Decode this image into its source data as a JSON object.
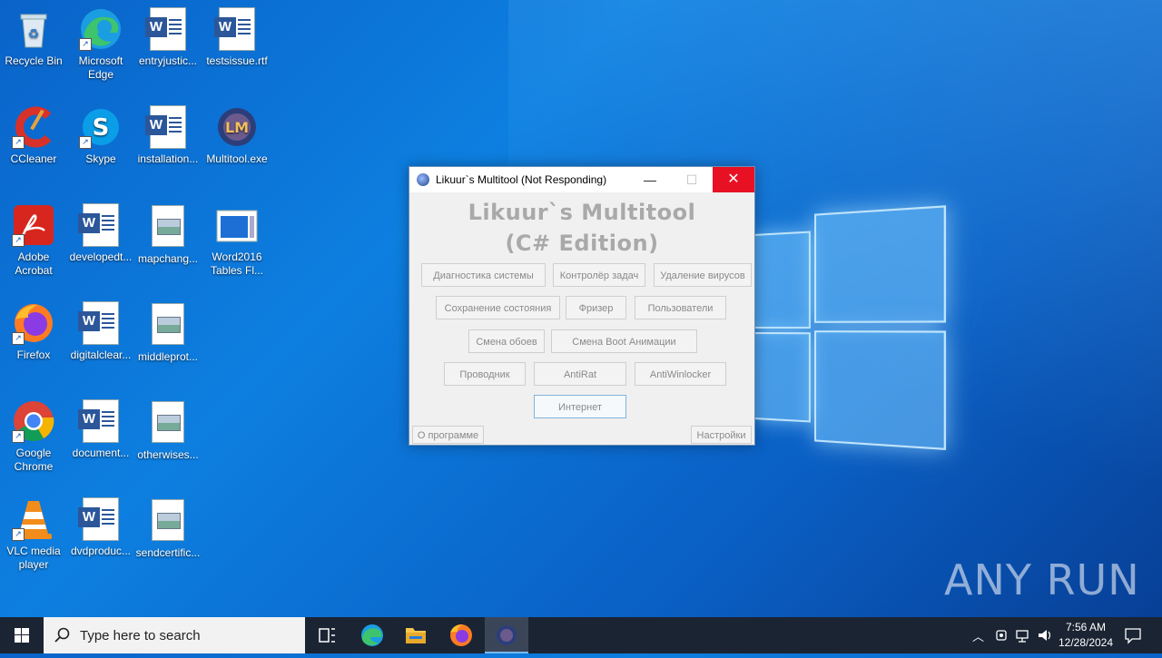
{
  "desktop": {
    "icons": [
      {
        "label": "Recycle Bin"
      },
      {
        "label": "Microsoft Edge"
      },
      {
        "label": "entryjustic..."
      },
      {
        "label": "testsissue.rtf"
      },
      {
        "label": "CCleaner"
      },
      {
        "label": "Skype"
      },
      {
        "label": "installation..."
      },
      {
        "label": "Multitool.exe"
      },
      {
        "label": "Adobe Acrobat"
      },
      {
        "label": "developedt..."
      },
      {
        "label": "mapchang..."
      },
      {
        "label": "Word2016 Tables Fl..."
      },
      {
        "label": "Firefox"
      },
      {
        "label": "digitalclear..."
      },
      {
        "label": "middleprot..."
      },
      {
        "label": "Google Chrome"
      },
      {
        "label": "document..."
      },
      {
        "label": "otherwises..."
      },
      {
        "label": "VLC media player"
      },
      {
        "label": "dvdproduc..."
      },
      {
        "label": "sendcertific..."
      }
    ]
  },
  "dialog": {
    "title": "Likuur`s Multitool (Not Responding)",
    "heading_line1": "Likuur`s Multitool",
    "heading_line2": "(C# Edition)",
    "buttons": {
      "diag": "Диагностика системы",
      "taskmgr": "Контролёр задач",
      "virus": "Удаление вирусов",
      "save": "Сохранение состояния",
      "freezer": "Фризер",
      "users": "Пользователи",
      "wallpaper": "Смена обоев",
      "boot": "Смена Boot Анимации",
      "explorer": "Проводник",
      "antirat": "AntiRat",
      "antiwinlocker": "AntiWinlocker",
      "internet": "Интернет",
      "about": "О программе",
      "settings": "Настройки"
    }
  },
  "taskbar": {
    "search_placeholder": "Type here to search",
    "time": "7:56 AM",
    "date": "12/28/2024"
  },
  "watermark": "ANY RUN"
}
